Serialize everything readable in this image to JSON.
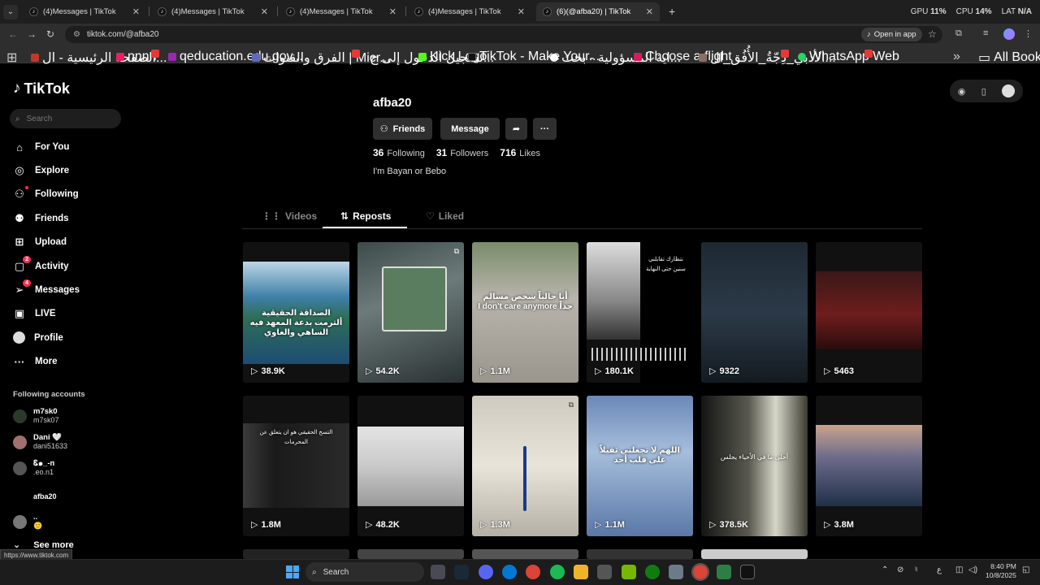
{
  "browser": {
    "tabs": [
      {
        "title": "(4)Messages | TikTok",
        "active": false
      },
      {
        "title": "(4)Messages | TikTok",
        "active": false
      },
      {
        "title": "(4)Messages | TikTok",
        "active": false
      },
      {
        "title": "(4)Messages | TikTok",
        "active": false
      },
      {
        "title": "(6)‎(@afba20) | TikTok",
        "active": true
      }
    ],
    "perf": {
      "gpu_label": "GPU",
      "gpu_value": "11%",
      "cpu_label": "CPU",
      "cpu_value": "14%",
      "lat_label": "LAT",
      "lat_value": "N/A"
    },
    "url": "tiktok.com/@afba20",
    "open_in_app": "Open in app",
    "bookmarks": [
      "الصفحة الرئيسية - ال...",
      "nnnn",
      "qeducation.edu.gov...",
      "الفرق والقنوات | Micr...",
      "تسجيل الدخول إلى ح...",
      "Kick Logo",
      "TikTok - Make Your...",
      "اية المسؤولية - بحث...",
      "Choose a flight",
      "الأدبي_دِجّةُ_الأُفُق_ال...",
      "WhatsApp Web"
    ],
    "all_bookmarks": "All Bookmarks"
  },
  "sidebar": {
    "logo": "TikTok",
    "search_placeholder": "Search",
    "nav": [
      {
        "label": "For You",
        "icon": "home-icon"
      },
      {
        "label": "Explore",
        "icon": "compass-icon"
      },
      {
        "label": "Following",
        "icon": "following-icon"
      },
      {
        "label": "Friends",
        "icon": "friends-icon"
      },
      {
        "label": "Upload",
        "icon": "upload-icon"
      },
      {
        "label": "Activity",
        "icon": "activity-icon",
        "badge": "2"
      },
      {
        "label": "Messages",
        "icon": "messages-icon",
        "badge": "4"
      },
      {
        "label": "LIVE",
        "icon": "live-icon"
      },
      {
        "label": "Profile",
        "icon": "profile-icon"
      },
      {
        "label": "More",
        "icon": "more-icon"
      }
    ],
    "following_title": "Following accounts",
    "accounts": [
      {
        "name": "m7sk0",
        "username": "m7sk07"
      },
      {
        "name": "Dani 🤍",
        "username": "dani51633"
      },
      {
        "name": "Ꮛ๑_-п",
        "username": ".eo.n1"
      },
      {
        "name": "",
        "username": "afba20"
      },
      {
        "name": "..",
        "username": "🙂"
      }
    ],
    "see_more": "See more",
    "status_url": "https://www.tiktok.com"
  },
  "profile": {
    "username": "afba20",
    "friends_btn": "Friends",
    "message_btn": "Message",
    "following_count": "36",
    "following_label": "Following",
    "followers_count": "31",
    "followers_label": "Followers",
    "likes_count": "716",
    "likes_label": "Likes",
    "bio": "I'm Bayan or Bebo",
    "tabs": [
      "Videos",
      "Reposts",
      "Liked"
    ]
  },
  "videos": [
    {
      "views": "38.9K",
      "caption": "الصداقة الحقيقية ألترمت بدعة المعهد فيه الساهي والعاوي"
    },
    {
      "views": "54.2K",
      "caption": ""
    },
    {
      "views": "1.1M",
      "caption": "أنا حالياً شخص مسالم جداً I don't care anymore"
    },
    {
      "views": "180.1K",
      "caption": "نتظارك تقابلني سنين حتى النهاية"
    },
    {
      "views": "9322",
      "caption": ""
    },
    {
      "views": "5463",
      "caption": ""
    },
    {
      "views": "1.8M",
      "caption": "التسخ الحقيقي هو ان يتعلق عن المحرمات"
    },
    {
      "views": "48.2K",
      "caption": ""
    },
    {
      "views": "1.3M",
      "caption": ""
    },
    {
      "views": "1.1M",
      "caption": "اللهم لا تجعلني ثقيلاً على قلب أحد"
    },
    {
      "views": "378.5K",
      "caption": "أحلى ما في الأحياء يجلس"
    },
    {
      "views": "3.8M",
      "caption": ""
    }
  ],
  "taskbar": {
    "search": "Search",
    "time": "8:40 PM",
    "date": "10/8/2025",
    "lang": "ع"
  }
}
